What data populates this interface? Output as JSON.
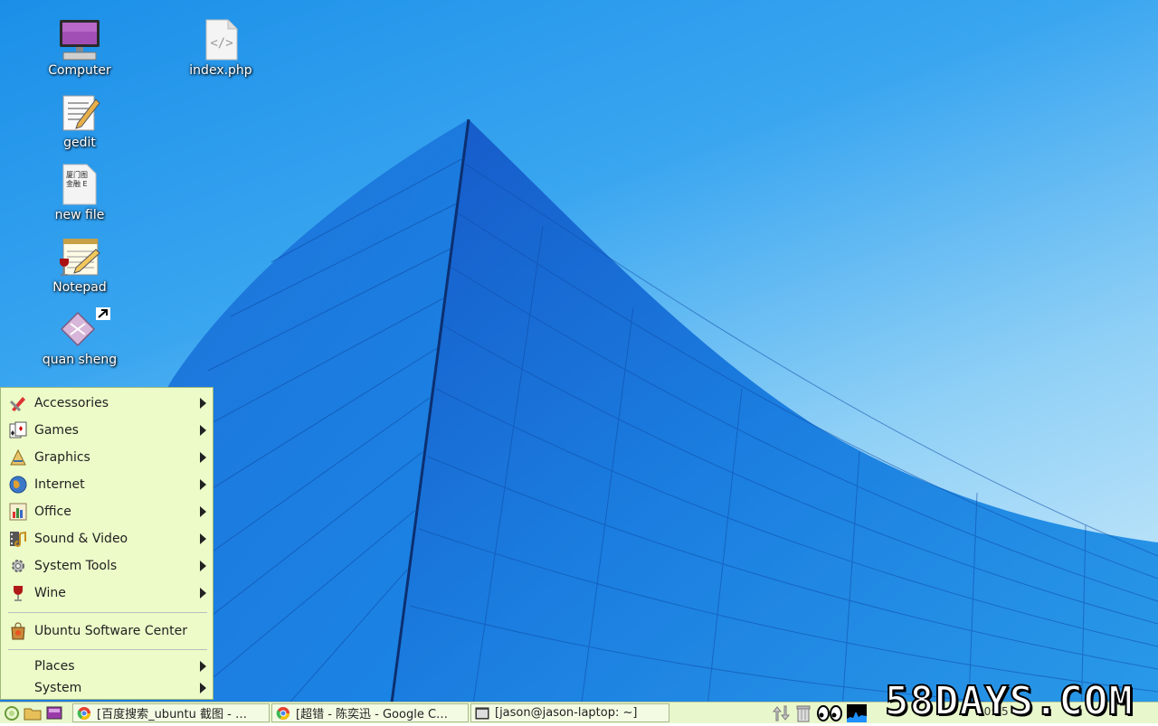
{
  "desktop": {
    "icons": [
      {
        "label": "Computer",
        "icon": "computer-icon"
      },
      {
        "label": "index.php",
        "icon": "php-file-icon"
      },
      {
        "label": "gedit",
        "icon": "gedit-icon"
      },
      {
        "label": "new file",
        "icon": "text-file-icon"
      },
      {
        "label": "Notepad",
        "icon": "notepad-icon"
      },
      {
        "label": "quan sheng",
        "icon": "app-shortcut-icon"
      }
    ],
    "new_file_preview": [
      "厦门图",
      "金融 E"
    ]
  },
  "menu": {
    "items": [
      {
        "label": "Accessories",
        "icon": "accessories-icon"
      },
      {
        "label": "Games",
        "icon": "games-icon"
      },
      {
        "label": "Graphics",
        "icon": "graphics-icon"
      },
      {
        "label": "Internet",
        "icon": "internet-icon"
      },
      {
        "label": "Office",
        "icon": "office-icon"
      },
      {
        "label": "Sound & Video",
        "icon": "sound-video-icon"
      },
      {
        "label": "System Tools",
        "icon": "system-tools-icon"
      },
      {
        "label": "Wine",
        "icon": "wine-icon"
      }
    ],
    "software_center": "Ubuntu Software Center",
    "places": "Places",
    "system": "System"
  },
  "taskbar": {
    "tasks": [
      {
        "label": "[百度搜索_ubuntu 截图 - …",
        "icon": "chrome-icon"
      },
      {
        "label": "[超错 - 陈奕迅 - Google C…",
        "icon": "chrome-icon"
      },
      {
        "label": "[jason@jason-laptop: ~]",
        "icon": "terminal-icon"
      }
    ],
    "clock": "20:55"
  },
  "watermark": "58DAYS.COM",
  "colors": {
    "menu_bg": "#ecfbc8",
    "taskbar_bg": "#e9f7cc",
    "sky": "#1b8fe8"
  }
}
